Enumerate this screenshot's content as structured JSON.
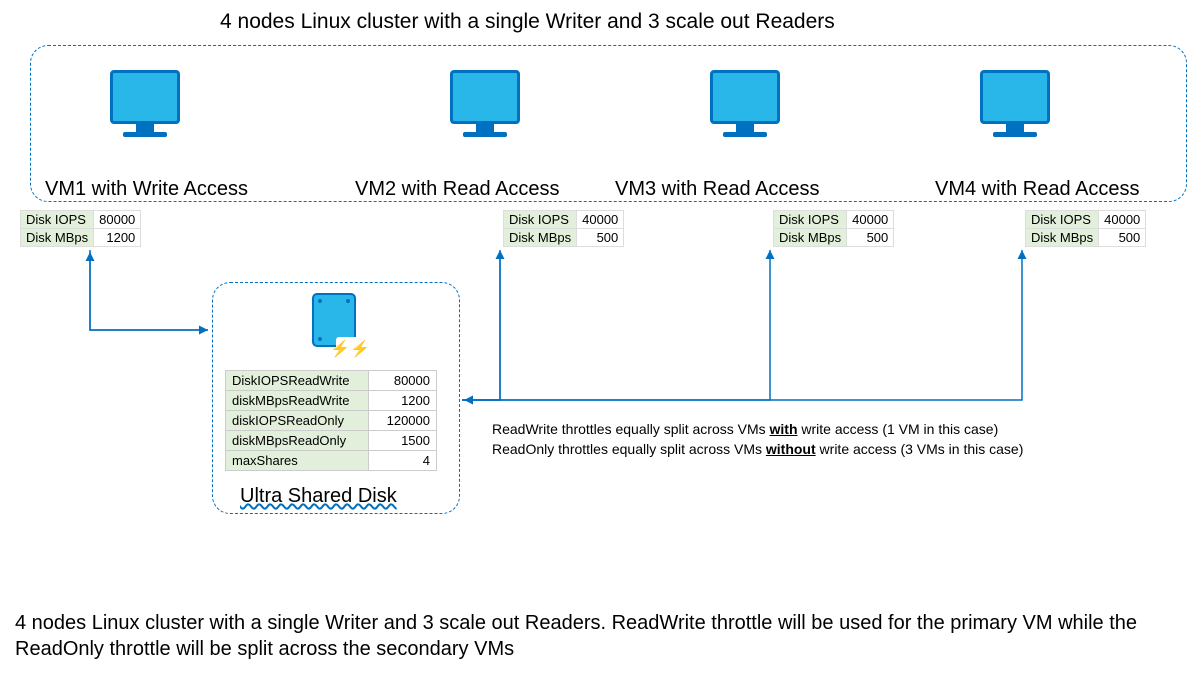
{
  "title": "4 nodes Linux cluster with a single Writer and 3 scale out Readers",
  "vms": [
    {
      "label": "VM1 with Write Access",
      "iops_label": "Disk IOPS",
      "iops": "80000",
      "mbps_label": "Disk MBps",
      "mbps": "1200"
    },
    {
      "label": "VM2 with Read Access",
      "iops_label": "Disk IOPS",
      "iops": "40000",
      "mbps_label": "Disk MBps",
      "mbps": "500"
    },
    {
      "label": "VM3 with Read Access",
      "iops_label": "Disk IOPS",
      "iops": "40000",
      "mbps_label": "Disk MBps",
      "mbps": "500"
    },
    {
      "label": "VM4 with Read Access",
      "iops_label": "Disk IOPS",
      "iops": "40000",
      "mbps_label": "Disk MBps",
      "mbps": "500"
    }
  ],
  "disk": {
    "title": "Ultra Shared Disk",
    "rows": [
      {
        "label": "DiskIOPSReadWrite",
        "value": "80000"
      },
      {
        "label": "diskMBpsReadWrite",
        "value": "1200"
      },
      {
        "label": "diskIOPSReadOnly",
        "value": "120000"
      },
      {
        "label": "diskMBpsReadOnly",
        "value": "1500"
      },
      {
        "label": "maxShares",
        "value": "4"
      }
    ]
  },
  "note": {
    "line1a": "ReadWrite throttles equally split across VMs ",
    "line1b": "with",
    "line1c": " write access (1 VM in this case)",
    "line2a": "ReadOnly throttles equally split across VMs ",
    "line2b": "without",
    "line2c": " write access (3 VMs in this case)"
  },
  "caption": "4 nodes Linux cluster with a single Writer and 3 scale out Readers. ReadWrite throttle will be used for the primary VM while the ReadOnly throttle will be split across the secondary VMs"
}
